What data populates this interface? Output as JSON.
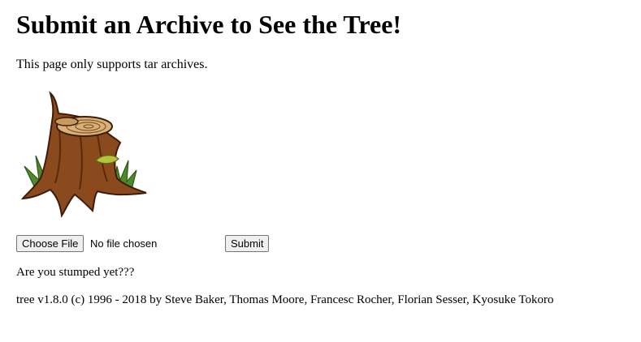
{
  "page": {
    "title": "Submit an Archive to See the Tree!",
    "note": "This page only supports tar archives."
  },
  "image": {
    "icon": "tree-stump-icon"
  },
  "form": {
    "choose_file_label": "Choose File",
    "file_status": "No file chosen",
    "submit_label": "Submit"
  },
  "footer": {
    "question": "Are you stumped yet???",
    "credit": "tree v1.8.0 (c) 1996 - 2018 by Steve Baker, Thomas Moore, Francesc Rocher, Florian Sesser, Kyosuke Tokoro"
  }
}
